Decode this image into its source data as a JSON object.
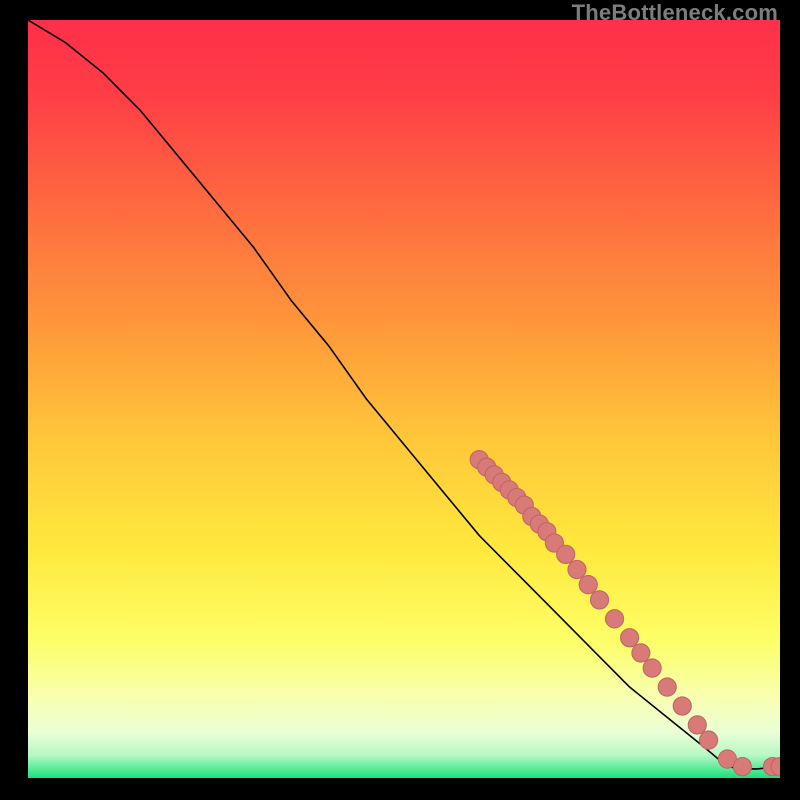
{
  "watermark": "TheBottleneck.com",
  "chart_data": {
    "type": "line",
    "title": "",
    "xlabel": "",
    "ylabel": "",
    "xlim": [
      0,
      100
    ],
    "ylim": [
      0,
      100
    ],
    "curve": [
      {
        "x": 0,
        "y": 100
      },
      {
        "x": 5,
        "y": 97
      },
      {
        "x": 10,
        "y": 93
      },
      {
        "x": 15,
        "y": 88
      },
      {
        "x": 20,
        "y": 82
      },
      {
        "x": 25,
        "y": 76
      },
      {
        "x": 30,
        "y": 70
      },
      {
        "x": 35,
        "y": 63
      },
      {
        "x": 40,
        "y": 57
      },
      {
        "x": 45,
        "y": 50
      },
      {
        "x": 50,
        "y": 44
      },
      {
        "x": 55,
        "y": 38
      },
      {
        "x": 60,
        "y": 32
      },
      {
        "x": 65,
        "y": 27
      },
      {
        "x": 70,
        "y": 22
      },
      {
        "x": 75,
        "y": 17
      },
      {
        "x": 80,
        "y": 12
      },
      {
        "x": 85,
        "y": 8
      },
      {
        "x": 90,
        "y": 4
      },
      {
        "x": 93,
        "y": 1.5
      },
      {
        "x": 95,
        "y": 1.2
      },
      {
        "x": 97,
        "y": 1.2
      },
      {
        "x": 100,
        "y": 1.5
      }
    ],
    "dots": [
      {
        "x": 60,
        "y": 42
      },
      {
        "x": 61,
        "y": 41
      },
      {
        "x": 62,
        "y": 40
      },
      {
        "x": 63,
        "y": 39
      },
      {
        "x": 64,
        "y": 38
      },
      {
        "x": 65,
        "y": 37
      },
      {
        "x": 66,
        "y": 36
      },
      {
        "x": 67,
        "y": 34.5
      },
      {
        "x": 68,
        "y": 33.5
      },
      {
        "x": 69,
        "y": 32.5
      },
      {
        "x": 70,
        "y": 31
      },
      {
        "x": 71.5,
        "y": 29.5
      },
      {
        "x": 73,
        "y": 27.5
      },
      {
        "x": 74.5,
        "y": 25.5
      },
      {
        "x": 76,
        "y": 23.5
      },
      {
        "x": 78,
        "y": 21
      },
      {
        "x": 80,
        "y": 18.5
      },
      {
        "x": 81.5,
        "y": 16.5
      },
      {
        "x": 83,
        "y": 14.5
      },
      {
        "x": 85,
        "y": 12
      },
      {
        "x": 87,
        "y": 9.5
      },
      {
        "x": 89,
        "y": 7
      },
      {
        "x": 90.5,
        "y": 5
      },
      {
        "x": 93,
        "y": 2.5
      },
      {
        "x": 95,
        "y": 1.5
      },
      {
        "x": 99,
        "y": 1.5
      },
      {
        "x": 100,
        "y": 1.5
      }
    ],
    "gradient_stops": [
      {
        "pct": 0,
        "color": "#ff2f49"
      },
      {
        "pct": 10,
        "color": "#ff3e46"
      },
      {
        "pct": 25,
        "color": "#ff6b3f"
      },
      {
        "pct": 40,
        "color": "#ff963b"
      },
      {
        "pct": 55,
        "color": "#ffc63a"
      },
      {
        "pct": 70,
        "color": "#ffe93d"
      },
      {
        "pct": 82,
        "color": "#fdff68"
      },
      {
        "pct": 90,
        "color": "#f7ffb6"
      },
      {
        "pct": 94,
        "color": "#e9ffd6"
      },
      {
        "pct": 97,
        "color": "#b7f7c4"
      },
      {
        "pct": 100,
        "color": "#18e27c"
      }
    ],
    "colors": {
      "curve": "#000000",
      "dot_fill": "#d87a78",
      "dot_stroke": "#c06866",
      "bg": "#000000"
    }
  }
}
